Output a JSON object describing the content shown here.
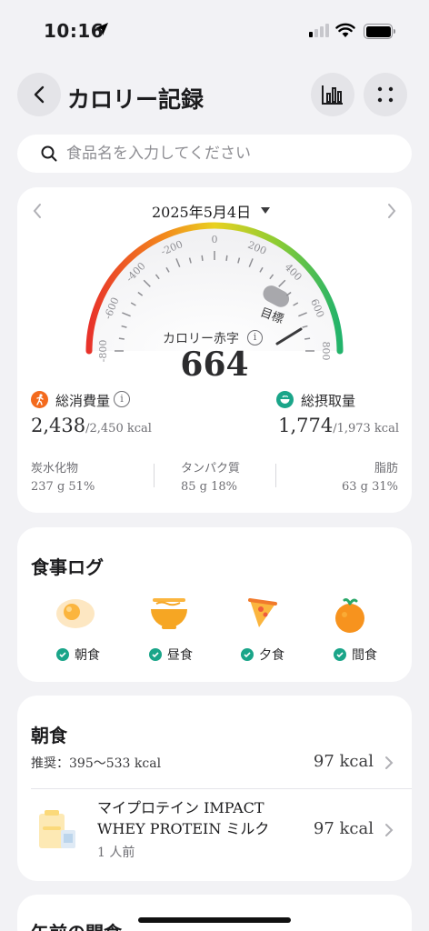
{
  "status": {
    "time": "10:16"
  },
  "header": {
    "title": "カロリー記録"
  },
  "search": {
    "placeholder": "食品名を入力してください"
  },
  "summary": {
    "date": "2025年5月4日",
    "gauge": {
      "ticks": [
        "-800",
        "-600",
        "-400",
        "-200",
        "0",
        "200",
        "400",
        "600",
        "800"
      ],
      "target_label": "目標"
    },
    "deficit_label": "カロリー赤字",
    "deficit_value": "664",
    "burn": {
      "label": "総消費量",
      "value": "2,438",
      "total": "/2,450 kcal"
    },
    "intake": {
      "label": "総摂取量",
      "value": "1,774",
      "total": "/1,973 kcal"
    },
    "macros": [
      {
        "name": "炭水化物",
        "value": "237 g  51%"
      },
      {
        "name": "タンパク質",
        "value": "85 g  18%"
      },
      {
        "name": "脂肪",
        "value": "63 g  31%"
      }
    ]
  },
  "meal_log": {
    "title": "食事ログ",
    "meals": [
      {
        "label": "朝食",
        "icon": "egg-icon"
      },
      {
        "label": "昼食",
        "icon": "ramen-bowl-icon"
      },
      {
        "label": "夕食",
        "icon": "pizza-slice-icon"
      },
      {
        "label": "間食",
        "icon": "orange-icon"
      }
    ]
  },
  "breakfast": {
    "title": "朝食",
    "recommendation": "推奨：395〜533 kcal",
    "total": "97 kcal",
    "items": [
      {
        "name_line1": "マイプロテイン IMPACT",
        "name_line2": "WHEY PROTEIN ミルク",
        "serving": "1 人前",
        "kcal": "97 kcal",
        "icon": "protein-bag-icon"
      }
    ]
  },
  "next_section": {
    "title": "午前の間食"
  },
  "colors": {
    "accent_green": "#1aa589",
    "accent_orange": "#f36a1d",
    "background": "#f2f2f5"
  }
}
